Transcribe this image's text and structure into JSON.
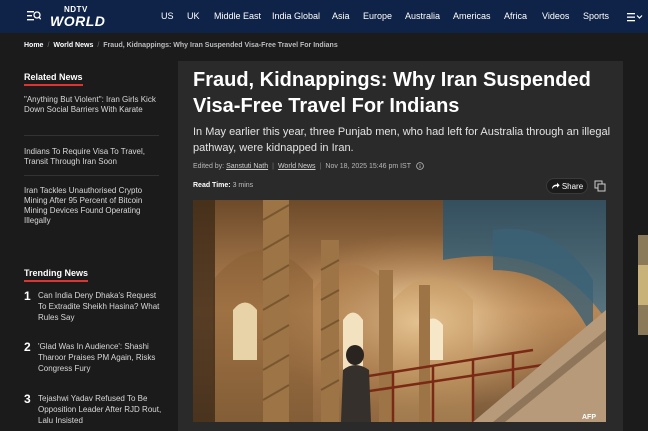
{
  "brand": {
    "top": "NDTV",
    "bottom": "WORLD"
  },
  "nav": {
    "items": [
      "US",
      "UK",
      "Middle East",
      "India Global",
      "Asia",
      "Europe",
      "Australia",
      "Americas",
      "Africa",
      "Videos",
      "Sports"
    ],
    "menu_icon": "menu-search-icon",
    "more_icon": "more-chevron-icon"
  },
  "breadcrumb": {
    "home": "Home",
    "section": "World News",
    "current": "Fraud, Kidnappings: Why Iran Suspended Visa-Free Travel For Indians"
  },
  "related": {
    "heading": "Related News",
    "items": [
      "\"Anything But Violent\": Iran Girls Kick Down Social Barriers With Karate",
      "Indians To Require Visa To Travel, Transit Through Iran Soon",
      "Iran Tackles Unauthorised Crypto Mining After 95 Percent of Bitcoin Mining Devices Found Operating Illegally"
    ]
  },
  "trending": {
    "heading": "Trending News",
    "items": [
      {
        "num": "1",
        "text": "Can India Deny Dhaka's Request To Extradite Sheikh Hasina? What Rules Say"
      },
      {
        "num": "2",
        "text": "'Glad Was In Audience': Shashi Tharoor Praises PM Again, Risks Congress Fury"
      },
      {
        "num": "3",
        "text": "Tejashwi Yadav Refused To Be Opposition Leader After RJD Rout, Lalu Insisted"
      }
    ]
  },
  "article": {
    "headline": "Fraud, Kidnappings: Why Iran Suspended Visa-Free Travel For Indians",
    "summary": "In May earlier this year, three Punjab men, who had left for Australia through an illegal pathway, were kidnapped in Iran.",
    "edited_by_label": "Edited by:",
    "editor": "Sanstuti Nath",
    "section": "World News",
    "date": "Nov 18, 2025 15:46 pm IST",
    "read_time_label": "Read Time:",
    "read_time": "3 mins",
    "share_label": "Share",
    "image_credit": "AFP"
  },
  "colors": {
    "nav_bg": "#0e2347",
    "page_bg": "#1b1b1b",
    "article_bg": "#2a2a2a",
    "accent_red": "#dd3333"
  }
}
